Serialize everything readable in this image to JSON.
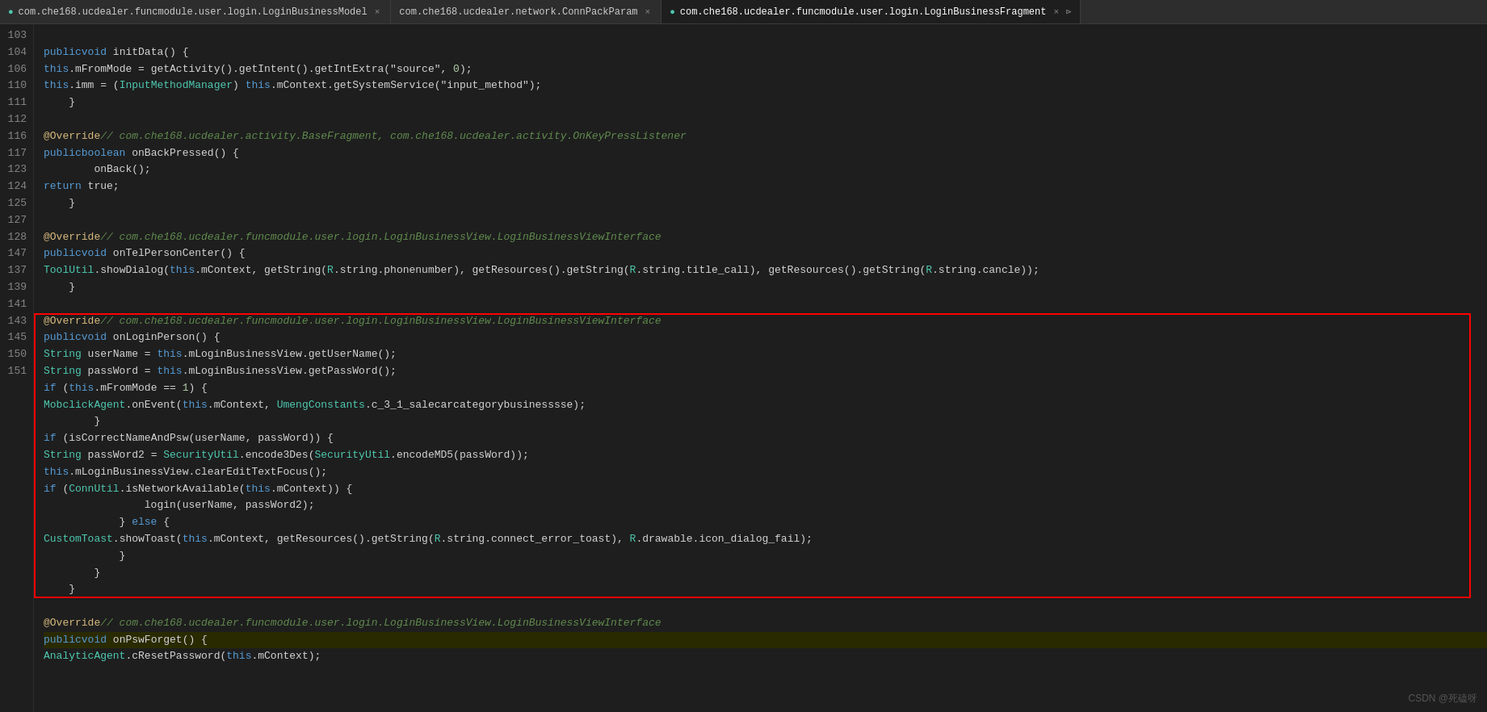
{
  "tabs": [
    {
      "id": "tab1",
      "label": "com.che168.ucdealer.funcmodule.user.login.LoginBusinessModel",
      "active": false,
      "icon": true
    },
    {
      "id": "tab2",
      "label": "com.che168.ucdealer.network.ConnPackParam",
      "active": false,
      "icon": false
    },
    {
      "id": "tab3",
      "label": "com.che168.ucdealer.funcmodule.user.login.LoginBusinessFragment",
      "active": true,
      "icon": true
    }
  ],
  "lines": [
    {
      "num": "",
      "code": "",
      "type": "blank"
    },
    {
      "num": "103",
      "raw": "    public void initData() {"
    },
    {
      "num": "104",
      "raw": "        this.mFromMode = getActivity().getIntent().getIntExtra(\"source\", 0);"
    },
    {
      "num": "106",
      "raw": "        this.imm = (InputMethodManager) this.mContext.getSystemService(\"input_method\");"
    },
    {
      "num": "",
      "raw": "    }"
    },
    {
      "num": "",
      "raw": ""
    },
    {
      "num": "",
      "raw": "    @Override // com.che168.ucdealer.activity.BaseFragment, com.che168.ucdealer.activity.OnKeyPressListener"
    },
    {
      "num": "110",
      "raw": "    public boolean onBackPressed() {"
    },
    {
      "num": "111",
      "raw": "        onBack();"
    },
    {
      "num": "112",
      "raw": "        return true;"
    },
    {
      "num": "",
      "raw": "    }"
    },
    {
      "num": "",
      "raw": ""
    },
    {
      "num": "",
      "raw": "    @Override // com.che168.ucdealer.funcmodule.user.login.LoginBusinessView.LoginBusinessViewInterface"
    },
    {
      "num": "116",
      "raw": "    public void onTelPersonCenter() {"
    },
    {
      "num": "117",
      "raw": "        ToolUtil.showDialog(this.mContext, getString(R.string.phonenumber), getResources().getString(R.string.title_call), getResources().getString(R.string.cancle));"
    },
    {
      "num": "",
      "raw": "    }"
    },
    {
      "num": "",
      "raw": ""
    },
    {
      "num": "",
      "raw": "    @Override // com.che168.ucdealer.funcmodule.user.login.LoginBusinessView.LoginBusinessViewInterface",
      "boxStart": true
    },
    {
      "num": "123",
      "raw": "    public void onLoginPerson() {"
    },
    {
      "num": "124",
      "raw": "        String userName = this.mLoginBusinessView.getUserName();"
    },
    {
      "num": "125",
      "raw": "        String passWord = this.mLoginBusinessView.getPassWord();"
    },
    {
      "num": "127",
      "raw": "        if (this.mFromMode == 1) {"
    },
    {
      "num": "128",
      "raw": "            MobclickAgent.onEvent(this.mContext, UmengConstants.c_3_1_salecarcategorybusinesssse);"
    },
    {
      "num": "",
      "raw": "        }"
    },
    {
      "num": "147",
      "raw": "        if (isCorrectNameAndPsw(userName, passWord)) {"
    },
    {
      "num": "137",
      "raw": "            String passWord2 = SecurityUtil.encode3Des(SecurityUtil.encodeMD5(passWord));"
    },
    {
      "num": "139",
      "raw": "            this.mLoginBusinessView.clearEditTextFocus();"
    },
    {
      "num": "141",
      "raw": "            if (ConnUtil.isNetworkAvailable(this.mContext)) {"
    },
    {
      "num": "143",
      "raw": "                login(userName, passWord2);"
    },
    {
      "num": "",
      "raw": "            } else {"
    },
    {
      "num": "145",
      "raw": "                CustomToast.showToast(this.mContext, getResources().getString(R.string.connect_error_toast), R.drawable.icon_dialog_fail);"
    },
    {
      "num": "",
      "raw": "            }"
    },
    {
      "num": "",
      "raw": "        }"
    },
    {
      "num": "",
      "raw": "    }",
      "boxEnd": true
    },
    {
      "num": "",
      "raw": ""
    },
    {
      "num": "",
      "raw": "    @Override // com.che168.ucdealer.funcmodule.user.login.LoginBusinessView.LoginBusinessViewInterface"
    },
    {
      "num": "150",
      "raw": "    public void onPswForget() {",
      "highlighted": true
    },
    {
      "num": "151",
      "raw": "        AnalyticAgent.cResetPassword(this.mContext);"
    }
  ],
  "watermark": "CSDN @死磕呀"
}
